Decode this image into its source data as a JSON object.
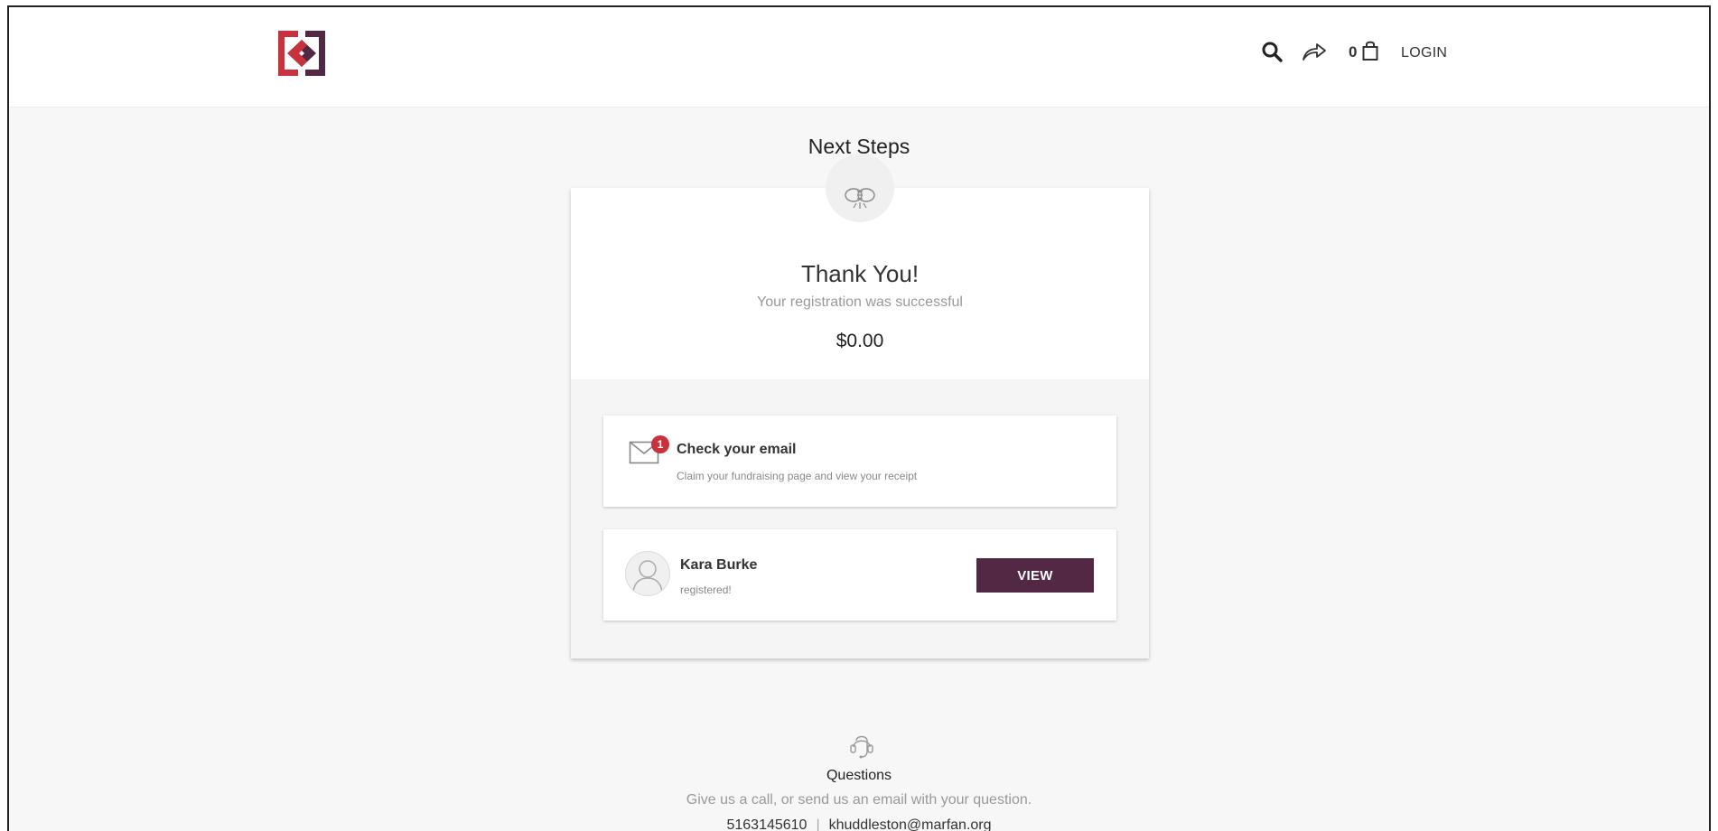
{
  "header": {
    "logo_name": "brand-logo",
    "cart_count": "0",
    "login_label": "LOGIN",
    "icons": [
      "search-icon",
      "share-icon",
      "shopping-bag-icon"
    ]
  },
  "page": {
    "title": "Next Steps"
  },
  "confirmation": {
    "title": "Thank You!",
    "subtitle": "Your registration was successful",
    "amount": "$0.00",
    "icon": "handshake-icon"
  },
  "steps": {
    "email": {
      "badge": "1",
      "title": "Check your email",
      "subtitle": "Claim your fundraising page and view your receipt",
      "icon": "envelope-icon"
    },
    "registrant": {
      "name": "Kara Burke",
      "status": "registered!",
      "button_label": "VIEW",
      "icon": "user-avatar-icon"
    }
  },
  "questions": {
    "title": "Questions",
    "description": "Give us a call, or send us an email with your question.",
    "phone": "5163145610",
    "separator": "|",
    "email": "khuddleston@marfan.org",
    "icon": "headset-icon"
  },
  "colors": {
    "brand_red": "#c8323c",
    "brand_purple": "#522844",
    "page_bg": "#f7f7f7"
  }
}
